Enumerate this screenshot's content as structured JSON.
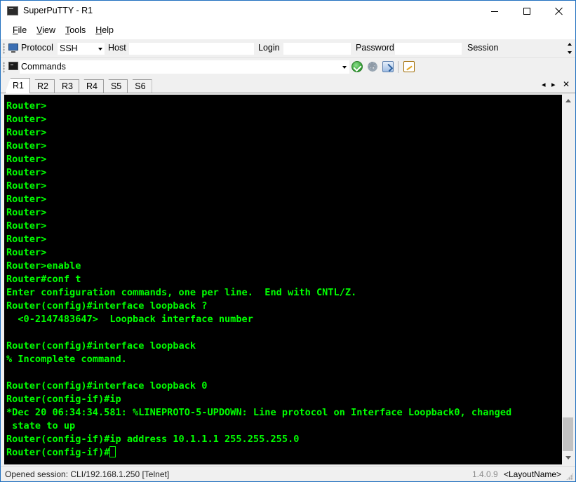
{
  "window": {
    "title": "SuperPuTTY - R1"
  },
  "menu": {
    "items": [
      {
        "accel": "F",
        "rest": "ile"
      },
      {
        "accel": "V",
        "rest": "iew"
      },
      {
        "accel": "T",
        "rest": "ools"
      },
      {
        "accel": "H",
        "rest": "elp"
      }
    ]
  },
  "connection_toolbar": {
    "protocol_label": "Protocol",
    "protocol_value": "SSH",
    "host_label": "Host",
    "host_value": "",
    "login_label": "Login",
    "login_value": "",
    "password_label": "Password",
    "password_value": "",
    "session_label": "Session"
  },
  "commands_toolbar": {
    "value": "Commands"
  },
  "tabs": {
    "items": [
      "R1",
      "R2",
      "R3",
      "R4",
      "S5",
      "S6"
    ],
    "active": "R1",
    "prev_glyph": "◂",
    "next_glyph": "▸",
    "close_glyph": "✕"
  },
  "terminal": {
    "colors": {
      "background": "#000000",
      "text": "#00ff00"
    },
    "lines": [
      "Router>",
      "Router>",
      "Router>",
      "Router>",
      "Router>",
      "Router>",
      "Router>",
      "Router>",
      "Router>",
      "Router>",
      "Router>",
      "Router>",
      "Router>enable",
      "Router#conf t",
      "Enter configuration commands, one per line.  End with CNTL/Z.",
      "Router(config)#interface loopback ?",
      "  <0-2147483647>  Loopback interface number",
      "",
      "Router(config)#interface loopback",
      "% Incomplete command.",
      "",
      "Router(config)#interface loopback 0",
      "Router(config-if)#ip",
      "*Dec 20 06:34:34.581: %LINEPROTO-5-UPDOWN: Line protocol on Interface Loopback0, changed",
      " state to up",
      "Router(config-if)#ip address 10.1.1.1 255.255.255.0",
      "Router(config-if)#"
    ]
  },
  "statusbar": {
    "session_text": "Opened session: CLI/192.168.1.250 [Telnet]",
    "version": "1.4.0.9",
    "layout": "<LayoutName>"
  }
}
